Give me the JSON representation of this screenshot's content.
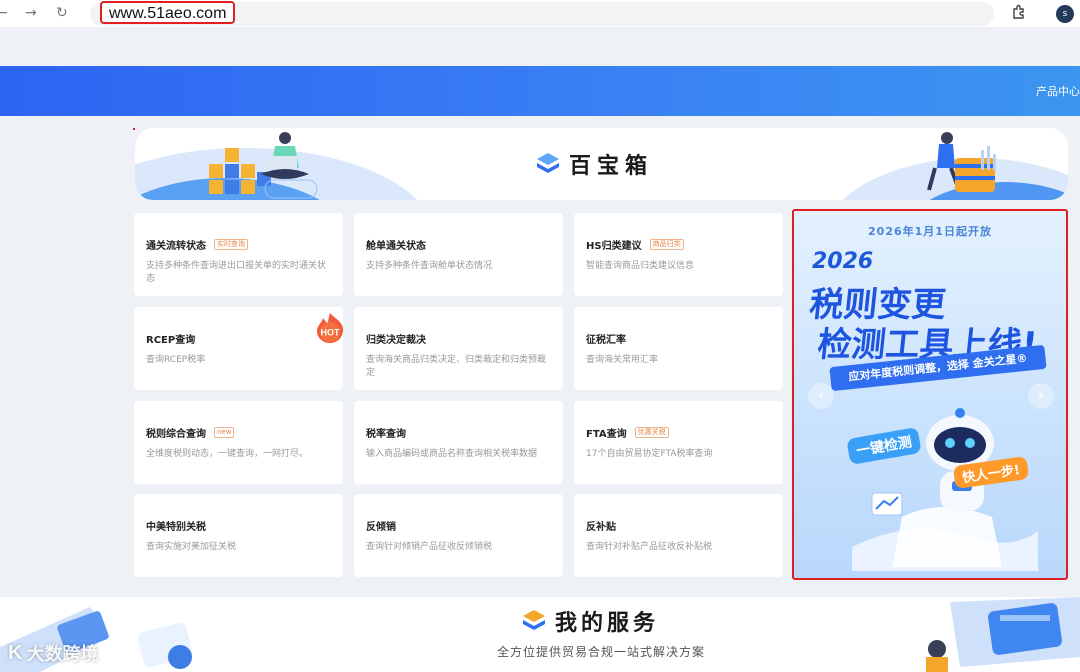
{
  "browser": {
    "url": "www.51aeo.com",
    "profile_initial": "s",
    "icons": [
      "back-icon",
      "forward-icon",
      "reload-icon",
      "extensions-icon"
    ]
  },
  "header": {
    "nav_partial": "产品中心"
  },
  "toolbox": {
    "title": "百宝箱",
    "cards": [
      {
        "title": "通关流转状态",
        "tag": "实时查询",
        "desc": "支持多种条件查询进出口报关单的实时通关状态"
      },
      {
        "title": "舱单通关状态",
        "tag": "",
        "desc": "支持多种条件查询舱单状态情况"
      },
      {
        "title": "HS归类建议",
        "tag": "商品归类",
        "desc": "智能查询商品归类建议信息"
      },
      {
        "title": "RCEP查询",
        "tag": "",
        "desc": "查询RCEP税率",
        "badge": "HOT"
      },
      {
        "title": "归类决定裁决",
        "tag": "",
        "desc": "查询海关商品归类决定、归类裁定和归类预裁定"
      },
      {
        "title": "征税汇率",
        "tag": "",
        "desc": "查询海关常用汇率"
      },
      {
        "title": "税则综合查询",
        "tag": "new",
        "desc": "全维度税则动态，一键查询，一网打尽。"
      },
      {
        "title": "税率查询",
        "tag": "",
        "desc": "输入商品编码或商品名称查询相关税率数据"
      },
      {
        "title": "FTA查询",
        "tag": "优惠关税",
        "desc": "17个自由贸易协定FTA税率查询"
      },
      {
        "title": "中美特别关税",
        "tag": "",
        "desc": "查询实施对美加征关税"
      },
      {
        "title": "反倾销",
        "tag": "",
        "desc": "查询针对倾销产品征收反倾销税"
      },
      {
        "title": "反补贴",
        "tag": "",
        "desc": "查询针对补贴产品征收反补贴税"
      }
    ]
  },
  "promo": {
    "date_line": "2026年1月1日起开放",
    "year": "2026",
    "headline1": "税则变更",
    "headline2": "检测工具上线!",
    "ribbon": "应对年度税则调整，选择 金关之星®",
    "bubble1": "一键检测",
    "bubble2": "快人一步!",
    "prev": "‹",
    "next": "›"
  },
  "services": {
    "title": "我的服务",
    "subtitle": "全方位提供贸易合规一站式解决方案"
  },
  "watermark": {
    "text": "大数跨境",
    "logo": "K"
  },
  "colors": {
    "accent": "#2f6ef0",
    "tag": "#e8864a",
    "highlight": "#e02020"
  }
}
